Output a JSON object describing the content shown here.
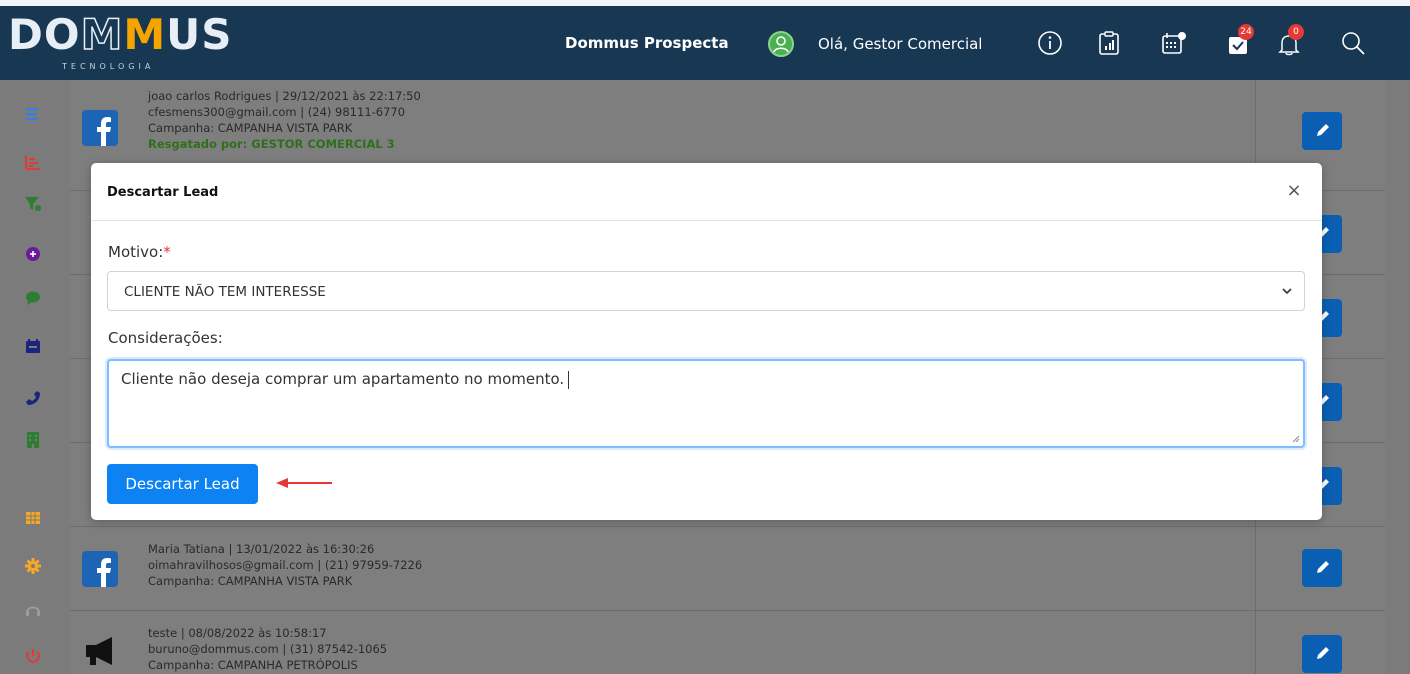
{
  "header": {
    "logo_text_a": "DO",
    "logo_text_m1": "M",
    "logo_text_m2": "M",
    "logo_text_b": "US",
    "logo_subtitle": "TECNOLOGIA",
    "brand": "Dommus Prospecta",
    "greeting": "Olá, Gestor Comercial",
    "tasks_badge": "24",
    "notifications_badge": "0",
    "icons": [
      "info-icon",
      "clipboard-chart-icon",
      "calendar-icon",
      "tasks-icon",
      "bell-icon",
      "search-icon"
    ]
  },
  "sidebar": {
    "icons": [
      "menu-icon",
      "chart-icon",
      "filter-icon",
      "add-circle-icon",
      "chat-icon",
      "calendar-icon",
      "phone-icon",
      "building-icon",
      "table-icon",
      "gear-icon",
      "headset-icon",
      "power-icon"
    ],
    "colors": [
      "#2e7df6",
      "#e53935",
      "#2e7d32",
      "#6a1b9a",
      "#2e7d32",
      "#1a237e",
      "#1a237e",
      "#2e7d32",
      "#f9a825",
      "#f9a825",
      "#9e9e9e",
      "#e53935"
    ]
  },
  "leads": [
    {
      "source_icon": "facebook-icon",
      "line1": "joao carlos Rodrigues | 29/12/2021 às 22:17:50",
      "line2": "cfesmens300@gmail.com | (24) 98111-6770",
      "line3": "Campanha: CAMPANHA VISTA PARK",
      "line4": "Resgatado por: GESTOR COMERCIAL 3"
    },
    {
      "source_icon": "facebook-icon",
      "line1": "Maria Tatiana | 13/01/2022 às 16:30:26",
      "line2": "oimahravilhosos@gmail.com | (21) 97959-7226",
      "line3": "Campanha: CAMPANHA VISTA PARK"
    },
    {
      "source_icon": "megaphone-icon",
      "line1": "teste | 08/08/2022 às 10:58:17",
      "line2": "buruno@dommus.com | (31) 87542-1065",
      "line3": "Campanha: CAMPANHA PETRÓPOLIS"
    }
  ],
  "modal": {
    "title": "Descartar Lead",
    "close": "×",
    "motivo_label": "Motivo:",
    "required_mark": "*",
    "motivo_value": "CLIENTE NÃO TEM INTERESSE",
    "consideracoes_label": "Considerações:",
    "consideracoes_value": "Cliente não deseja comprar um apartamento no momento.",
    "submit_label": "Descartar Lead",
    "accent_color": "#0d82f2",
    "annotation_color": "#e53935"
  }
}
